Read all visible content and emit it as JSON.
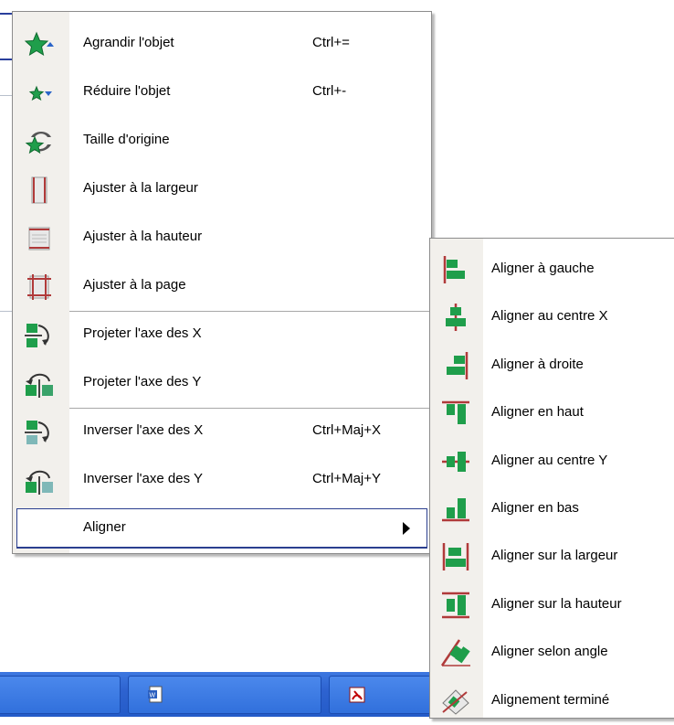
{
  "main_menu": {
    "items": [
      {
        "label": "Agrandir l'objet",
        "shortcut": "Ctrl+=",
        "icon": "star-enlarge-icon"
      },
      {
        "label": "Réduire l'objet",
        "shortcut": "Ctrl+-",
        "icon": "star-reduce-icon"
      },
      {
        "label": "Taille d'origine",
        "shortcut": "",
        "icon": "star-reset-icon"
      },
      {
        "label": "Ajuster à la largeur",
        "shortcut": "",
        "icon": "fit-width-icon"
      },
      {
        "label": "Ajuster à la hauteur",
        "shortcut": "",
        "icon": "fit-height-icon"
      },
      {
        "label": "Ajuster à la page",
        "shortcut": "",
        "icon": "fit-page-icon"
      },
      {
        "label": "Projeter l'axe des X",
        "shortcut": "",
        "icon": "project-x-icon"
      },
      {
        "label": "Projeter l'axe des Y",
        "shortcut": "",
        "icon": "project-y-icon"
      },
      {
        "label": "Inverser l'axe des X",
        "shortcut": "Ctrl+Maj+X",
        "icon": "flip-x-icon"
      },
      {
        "label": "Inverser l'axe des Y",
        "shortcut": "Ctrl+Maj+Y",
        "icon": "flip-y-icon"
      },
      {
        "label": "Aligner",
        "shortcut": "",
        "icon": ""
      }
    ]
  },
  "align_submenu": {
    "items": [
      {
        "label": "Aligner à gauche",
        "icon": "align-left-icon"
      },
      {
        "label": "Aligner au centre X",
        "icon": "align-center-x-icon"
      },
      {
        "label": "Aligner à droite",
        "icon": "align-right-icon"
      },
      {
        "label": "Aligner en haut",
        "icon": "align-top-icon"
      },
      {
        "label": "Aligner au centre Y",
        "icon": "align-center-y-icon"
      },
      {
        "label": "Aligner en bas",
        "icon": "align-bottom-icon"
      },
      {
        "label": "Aligner sur la largeur",
        "icon": "align-width-icon"
      },
      {
        "label": "Aligner sur la hauteur",
        "icon": "align-height-icon"
      },
      {
        "label": "Aligner selon angle",
        "icon": "align-angle-icon"
      },
      {
        "label": "Alignement terminé",
        "icon": "align-done-icon"
      }
    ]
  },
  "taskbar": {
    "buttons": [
      {
        "icon": "word-document-icon"
      },
      {
        "icon": "pdf-document-icon"
      }
    ]
  },
  "colors": {
    "menu_highlight_border": "#2b3f8f",
    "icon_green": "#1f9e4b",
    "icon_red": "#b03a3a",
    "taskbar_blue": "#2e63d0"
  }
}
